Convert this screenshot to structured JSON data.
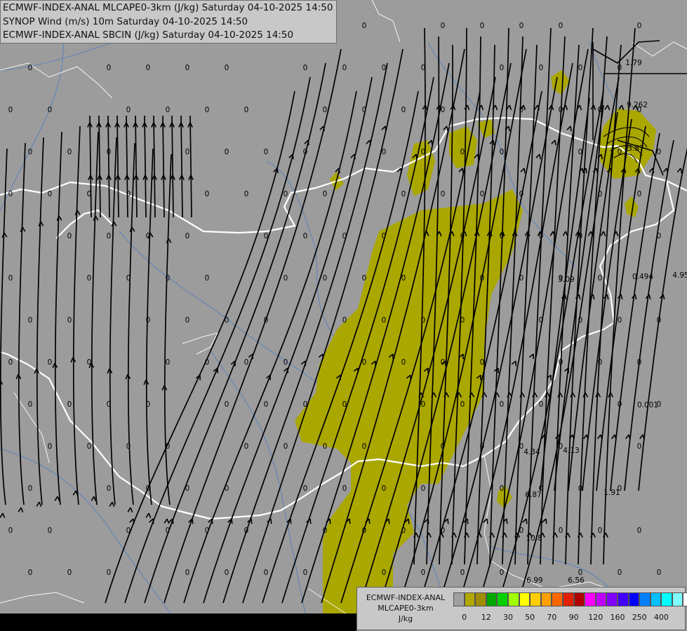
{
  "title_lines": [
    "ECMWF-INDEX-ANAL MLCAPE0-3km (J/kg) Saturday 04-10-2025 14:50",
    "SYNOP Wind (m/s) 10m Saturday 04-10-2025 14:50",
    "ECMWF-INDEX-ANAL SBCIN (J/kg) Saturday 04-10-2025 14:50"
  ],
  "legend": {
    "line1": "ECMWF-INDEX-ANAL",
    "line2": "MLCAPE0-3km",
    "unit": "J/kg",
    "colors": [
      "#a0a0a0",
      "#b0a800",
      "#a08c00",
      "#00a800",
      "#00d000",
      "#a0ff00",
      "#ffff00",
      "#ffcc00",
      "#ffa000",
      "#ff6600",
      "#e02000",
      "#b00000",
      "#ff00ff",
      "#c000ff",
      "#8000ff",
      "#4000ff",
      "#0000ff",
      "#0080ff",
      "#00c0ff",
      "#00ffff",
      "#80ffff",
      "#ffffff"
    ],
    "ticks": [
      {
        "label": "0",
        "i": 1
      },
      {
        "label": "12",
        "i": 3
      },
      {
        "label": "30",
        "i": 5
      },
      {
        "label": "50",
        "i": 7
      },
      {
        "label": "70",
        "i": 9
      },
      {
        "label": "90",
        "i": 11
      },
      {
        "label": "120",
        "i": 13
      },
      {
        "label": "160",
        "i": 15
      },
      {
        "label": "250",
        "i": 17
      },
      {
        "label": "400",
        "i": 19
      }
    ]
  },
  "cin_value_labels": [
    "1.79",
    "9.262",
    "3.87",
    "0.494",
    "4.95",
    "3.09",
    "0.001",
    "4.34",
    "4.13",
    "6.87",
    "1.91",
    "10.8",
    "6.99",
    "6.56"
  ]
}
